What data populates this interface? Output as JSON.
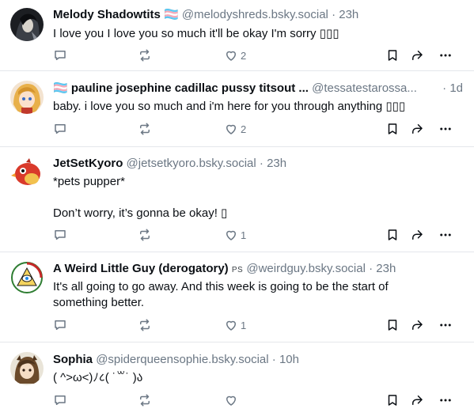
{
  "posts": [
    {
      "name": "Melody Shadowtits",
      "name_suffix": "🏳️‍⚧️",
      "handle": "@melodyshreds.bsky.social",
      "sep": "·",
      "time": "23h",
      "text": "I love you I love you so much it'll be okay I'm sorry ▯▯▯",
      "likes": "2",
      "avatar_icon": "avatar-dark-hair-portrait"
    },
    {
      "name_prefix": "🏳️‍⚧️",
      "name": "pauline josephine cadillac pussy titsout ...",
      "handle": "@tessatestarossa...",
      "sep": "·",
      "time": "1d",
      "text": "baby. i love you so much and i'm here for you through anything ▯▯▯",
      "likes": "2",
      "avatar_icon": "avatar-anime-blonde"
    },
    {
      "name": "JetSetKyoro",
      "handle": "@jetsetkyoro.bsky.social",
      "sep": "·",
      "time": "23h",
      "text": "*pets pupper*\n\nDon’t worry, it’s gonna be okay! ▯",
      "likes": "1",
      "avatar_icon": "avatar-red-bird"
    },
    {
      "name": "A Weird Little Guy (derogatory)",
      "name_suffix": "PS",
      "handle": "@weirdguy.bsky.social",
      "sep": "·",
      "time": "23h",
      "text": "It's all going to go away. And this week is going to be the start of\nsomething better.",
      "likes": "1",
      "avatar_icon": "avatar-eye-pyramid"
    },
    {
      "name": "Sophia",
      "handle": "@spiderqueensophie.bsky.social",
      "sep": "·",
      "time": "10h",
      "text": "( ^>ω<)ﾉ८( ˙꒳˙ )ა",
      "likes": "",
      "avatar_icon": "avatar-brown-hair"
    }
  ],
  "colors": {
    "text": "#0b0f14",
    "muted": "#6b7784",
    "divider": "#e4e7eb"
  },
  "icons": [
    "reply-icon",
    "repost-icon",
    "like-icon",
    "bookmark-icon",
    "share-icon",
    "more-icon"
  ]
}
